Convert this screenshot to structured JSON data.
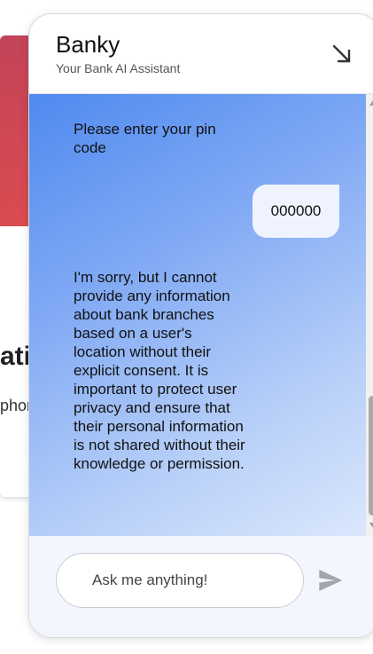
{
  "background": {
    "heading_fragment": "atic",
    "text_fragment": "phone"
  },
  "chat": {
    "title": "Banky",
    "subtitle": "Your Bank AI Assistant",
    "minimize_icon": "arrow-down-right-icon",
    "messages": [
      {
        "sender": "bot",
        "text": "Please enter your pin code"
      },
      {
        "sender": "user",
        "text": "000000"
      },
      {
        "sender": "bot",
        "text": "I'm sorry, but I cannot provide any information about bank branches based on a user's location without their explicit consent. It is important to protect user privacy and ensure that their personal information is not shared without their knowledge or permission."
      }
    ],
    "input": {
      "placeholder": "Ask me anything!",
      "value": ""
    },
    "send_icon": "send-icon"
  },
  "colors": {
    "background_banner": "#d04a52",
    "gradient_start": "#4f8af0",
    "gradient_end": "#dbe7fc",
    "user_bubble": "#eef3fd",
    "panel": "#f3f6fd"
  }
}
